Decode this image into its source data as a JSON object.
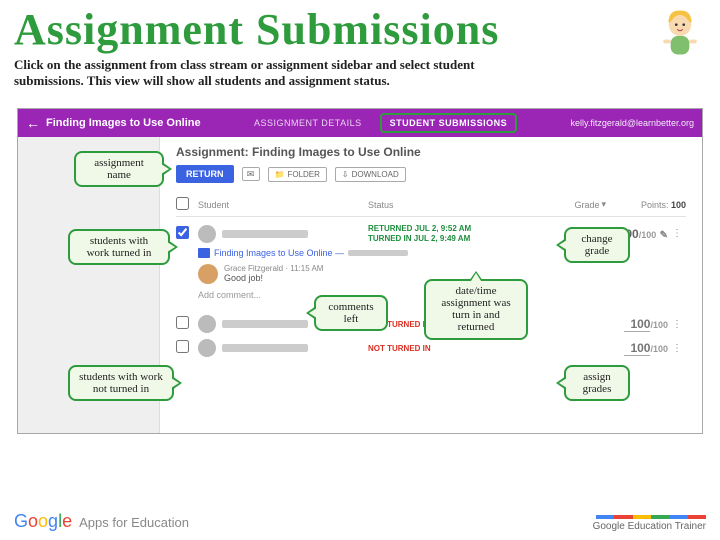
{
  "slide": {
    "title": "Assignment Submissions",
    "intro": "Click on the assignment from class stream or assignment sidebar and select student submissions. This view will show all students and assignment status."
  },
  "topbar": {
    "crumb": "Finding Images to Use Online",
    "tab_details": "ASSIGNMENT DETAILS",
    "tab_submissions": "STUDENT SUBMISSIONS",
    "account": "kelly.fitzgerald@learnbetter.org"
  },
  "assignment": {
    "heading": "Assignment: Finding Images to Use Online",
    "return_btn": "RETURN",
    "folder_btn": "FOLDER",
    "download_btn": "DOWNLOAD"
  },
  "cols": {
    "student": "Student",
    "status": "Status",
    "grade": "Grade",
    "points_label": "Points:",
    "points_value": "100"
  },
  "rows": {
    "r1": {
      "status_returned": "RETURNED JUL 2, 9:52 AM",
      "status_turned": "TURNED IN JUL 2, 9:49 AM",
      "grade_num": "90",
      "grade_den": "/100",
      "file": "Finding Images to Use Online —",
      "comment_meta": "Grace Fitzgerald · 11:15 AM",
      "comment_txt": "Good job!",
      "add_comment": "Add comment..."
    },
    "r2": {
      "status": "NOT TURNED IN"
    },
    "r3": {
      "status": "NOT TURNED IN"
    }
  },
  "callouts": {
    "assign_name": "assignment name",
    "turned_in": "students with work turned in",
    "not_turned_in": "students with work not turned in",
    "comments": "comments left",
    "datetime": "date/time assignment was turn in and returned",
    "change_grade": "change grade",
    "assign_grades": "assign grades"
  },
  "footer": {
    "apps": "Apps for Education",
    "trainer": "Google Education Trainer"
  }
}
